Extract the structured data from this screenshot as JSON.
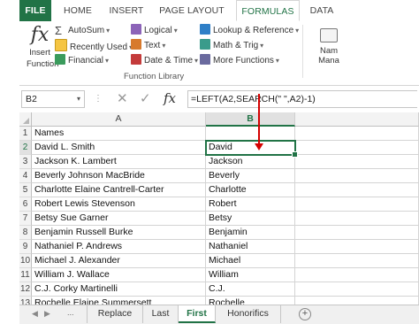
{
  "ribbon": {
    "tabs": [
      {
        "label": "FILE"
      },
      {
        "label": "HOME"
      },
      {
        "label": "INSERT"
      },
      {
        "label": "PAGE LAYOUT"
      },
      {
        "label": "FORMULAS"
      },
      {
        "label": "DATA"
      }
    ],
    "insert_function": {
      "line1": "Insert",
      "line2": "Function"
    },
    "commands": {
      "autosum": "AutoSum",
      "recently_used": "Recently Used",
      "financial": "Financial",
      "logical": "Logical",
      "text": "Text",
      "date_time": "Date & Time",
      "lookup_reference": "Lookup & Reference",
      "math_trig": "Math & Trig",
      "more_functions": "More Functions"
    },
    "group_label": "Function Library",
    "name_manager": {
      "line1": "Nam",
      "line2": "Mana"
    }
  },
  "formula_bar": {
    "name_box": "B2",
    "fx": "fx",
    "formula": "=LEFT(A2,SEARCH(\" \",A2)-1)"
  },
  "columns": [
    "A",
    "B"
  ],
  "rows": [
    {
      "num": "1",
      "a": "Names",
      "b": ""
    },
    {
      "num": "2",
      "a": "David L. Smith",
      "b": "David"
    },
    {
      "num": "3",
      "a": "Jackson K. Lambert",
      "b": "Jackson"
    },
    {
      "num": "4",
      "a": "Beverly Johnson MacBride",
      "b": "Beverly"
    },
    {
      "num": "5",
      "a": "Charlotte Elaine Cantrell-Carter",
      "b": "Charlotte"
    },
    {
      "num": "6",
      "a": "Robert Lewis Stevenson",
      "b": "Robert"
    },
    {
      "num": "7",
      "a": "Betsy Sue Garner",
      "b": "Betsy"
    },
    {
      "num": "8",
      "a": "Benjamin Russell Burke",
      "b": "Benjamin"
    },
    {
      "num": "9",
      "a": "Nathaniel P. Andrews",
      "b": "Nathaniel"
    },
    {
      "num": "10",
      "a": "Michael J. Alexander",
      "b": "Michael"
    },
    {
      "num": "11",
      "a": "William J. Wallace",
      "b": "William"
    },
    {
      "num": "12",
      "a": "C.J. Corky Martinelli",
      "b": "C.J."
    },
    {
      "num": "13",
      "a": "Rochelle Elaine Summersett",
      "b": "Rochelle"
    }
  ],
  "sheets": [
    {
      "label": "Replace",
      "active": false
    },
    {
      "label": "Last",
      "active": false
    },
    {
      "label": "First",
      "active": true
    },
    {
      "label": "Honorifics",
      "active": false
    }
  ],
  "nav": {
    "prev": "◀",
    "next": "▶",
    "more": "...",
    "add": "+"
  }
}
